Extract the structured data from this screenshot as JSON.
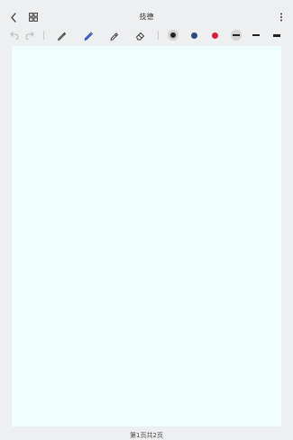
{
  "header": {
    "title": "技德"
  },
  "toolbar": {
    "pen_colors": [
      {
        "name": "black",
        "hex": "#222222",
        "selected": true
      },
      {
        "name": "blue",
        "hex": "#2c4a7e",
        "selected": false
      },
      {
        "name": "red",
        "hex": "#d6233a",
        "selected": false
      }
    ],
    "stroke_widths": [
      "thin",
      "medium",
      "thick"
    ],
    "selected_stroke": "thin",
    "accent_color": "#3a6fd8"
  },
  "canvas": {
    "background_color": "#f1feff"
  },
  "footer": {
    "page_info": "第1页共2页"
  }
}
